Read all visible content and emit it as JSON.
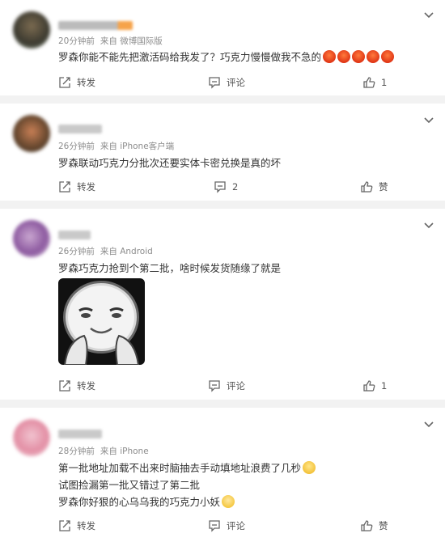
{
  "comments": [
    {
      "meta": {
        "time": "20分钟前",
        "source": "来自 微博国际版"
      },
      "lines": [
        "罗森你能不能先把激活码给我发了？巧克力慢慢做我不急的"
      ],
      "emoji_count": 5,
      "actions": {
        "repost": "转发",
        "comment": "评论",
        "like": "1"
      }
    },
    {
      "meta": {
        "time": "26分钟前",
        "source": "来自 iPhone客户端"
      },
      "lines": [
        "罗森联动巧克力分批次还要实体卡密兑换是真的坏"
      ],
      "actions": {
        "repost": "转发",
        "comment": "2",
        "like": "赞"
      }
    },
    {
      "meta": {
        "time": "26分钟前",
        "source": "来自 Android"
      },
      "lines": [
        "罗森巧克力抢到个第二批，啥时候发货随缘了就是"
      ],
      "actions": {
        "repost": "转发",
        "comment": "评论",
        "like": "1"
      }
    },
    {
      "meta": {
        "time": "28分钟前",
        "source": "来自 iPhone"
      },
      "lines": [
        "第一批地址加载不出来时脑抽去手动填地址浪费了几秒",
        "试图捡漏第一批又错过了第二批",
        "罗森你好狠的心乌乌我的巧克力小妖"
      ],
      "actions": {
        "repost": "转发",
        "comment": "评论",
        "like": "赞"
      }
    }
  ],
  "colors": {
    "background": "#f2f2f2",
    "card": "#ffffff",
    "meta_text": "#8c8c8c",
    "icon": "#666666"
  }
}
